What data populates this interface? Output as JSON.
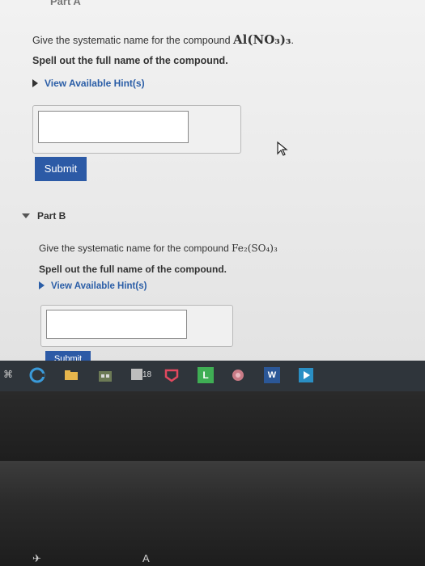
{
  "part_a": {
    "header": "Part A",
    "question_prefix": "Give the systematic name for the compound ",
    "formula": "Al(NO₃)₃",
    "question_suffix": ".",
    "instruction": "Spell out the full name of the compound.",
    "hint_label": "View Available Hint(s)",
    "answer_value": "",
    "submit_label": "Submit"
  },
  "part_b": {
    "header": "Part B",
    "question_prefix": "Give the systematic name for the compound ",
    "formula": "Fe₂(SO₄)₃",
    "instruction": "Spell out the full name of the compound.",
    "hint_label": "View Available Hint(s)",
    "answer_value": "",
    "submit_label": "Submit"
  },
  "taskbar": {
    "left_label": "⌘",
    "calendar_number": "18",
    "word_label": "W",
    "l_label": "L",
    "icons": [
      "edge-icon",
      "file-explorer-icon",
      "store-icon",
      "calendar-icon",
      "office-icon",
      "l-app-icon",
      "photos-icon",
      "word-icon",
      "media-icon"
    ]
  },
  "keyboard": {
    "glyph_1": "✈",
    "glyph_2": "A"
  },
  "colors": {
    "submit_blue": "#2c5aa6",
    "hint_blue": "#2b5ea7",
    "taskbar": "#2f353b"
  }
}
